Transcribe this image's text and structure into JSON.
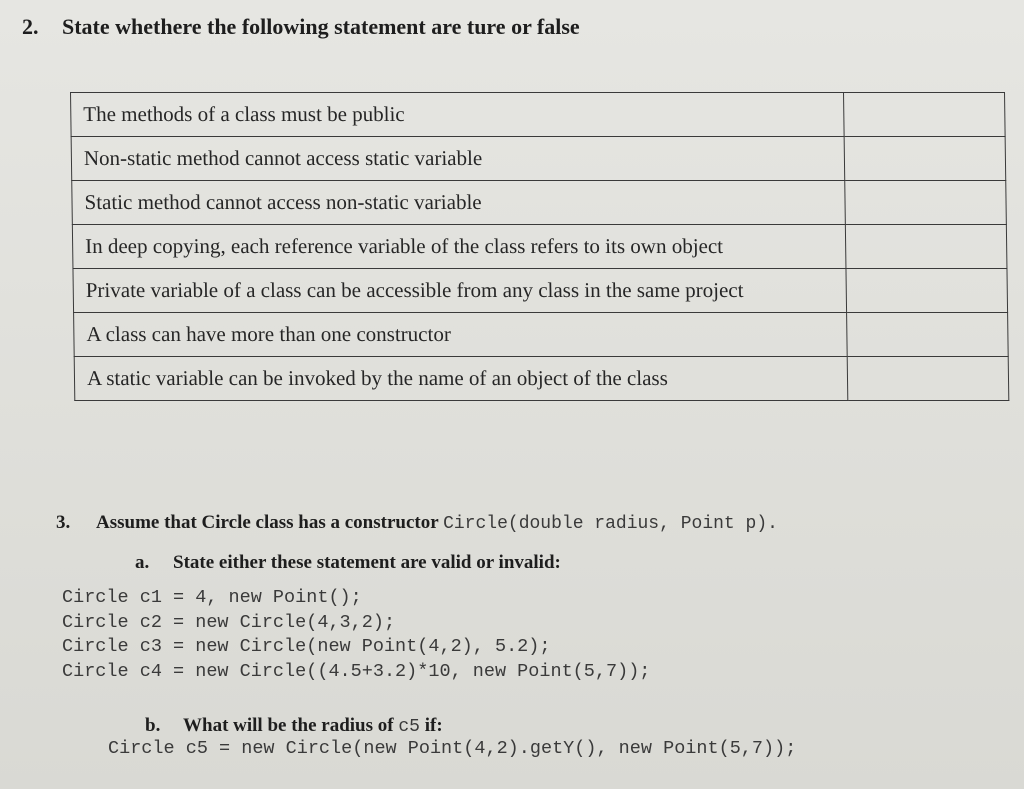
{
  "question2": {
    "number": "2.",
    "title": "State whethere the following statement are ture or false",
    "statements": [
      {
        "text": "The methods of a class must be public",
        "answer": ""
      },
      {
        "text": "Non-static method cannot access static variable",
        "answer": ""
      },
      {
        "text": "Static method cannot access non-static variable",
        "answer": ""
      },
      {
        "text": "In deep copying, each reference variable of the class refers to its own object",
        "answer": ""
      },
      {
        "text": "Private variable of a class can be accessible from any class in the same project",
        "answer": ""
      },
      {
        "text": "A class can have more than one constructor",
        "answer": ""
      },
      {
        "text": "A static variable can be invoked by the name of an object of the class",
        "answer": ""
      }
    ]
  },
  "question3": {
    "number": "3.",
    "intro": "Assume that Circle class has a constructor ",
    "constructor_code": "Circle(double radius, Point p).",
    "part_a": {
      "label": "a.",
      "text": "State either these statement are valid or invalid:",
      "code_lines": [
        "Circle c1 = 4, new Point();",
        "Circle c2 = new Circle(4,3,2);",
        "Circle c3 = new Circle(new Point(4,2), 5.2);",
        "Circle c4 = new Circle((4.5+3.2)*10, new Point(5,7));"
      ]
    },
    "part_b": {
      "label": "b.",
      "text": "What will be the radius of ",
      "var_code": "c5",
      "text_end": " if:",
      "code_line": "Circle c5 = new Circle(new Point(4,2).getY(), new Point(5,7));"
    }
  }
}
